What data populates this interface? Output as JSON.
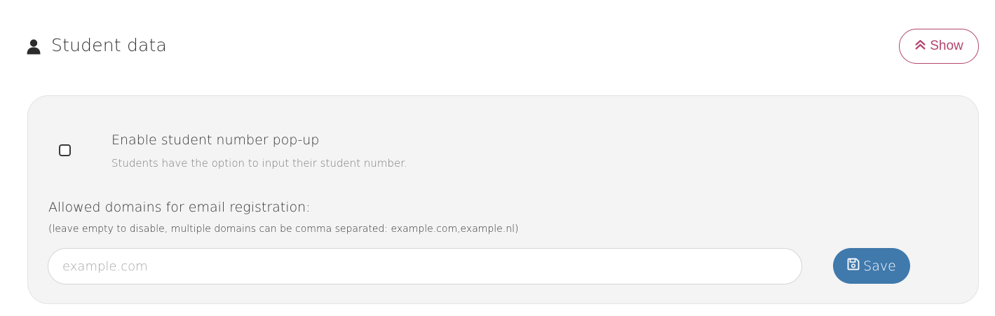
{
  "header": {
    "icon": "user-icon",
    "title": "Student data",
    "toggle": {
      "icon": "double-chevron-up-icon",
      "label": "Show",
      "color": "#b4466f"
    }
  },
  "settings": {
    "student_number_popup": {
      "checked": false,
      "label": "Enable student number pop-up",
      "description": "Students have the option to input their student number."
    },
    "allowed_domains": {
      "label": "Allowed domains for email registration:",
      "hint": "(leave empty to disable, multiple domains can be comma separated: example.com,example.nl)",
      "value": "",
      "placeholder": "example.com"
    },
    "save_button": {
      "icon": "floppy-disk-icon",
      "label": "Save",
      "color": "#4079ac"
    }
  }
}
